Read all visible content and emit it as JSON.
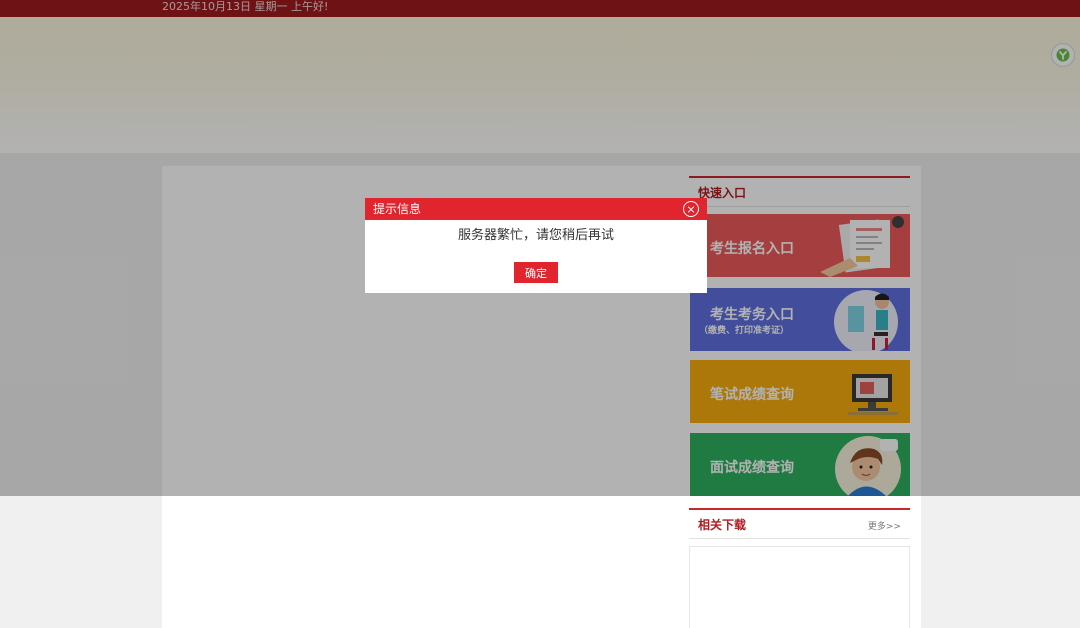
{
  "topbar": {
    "date_text": "2025年10月13日  星期一  上午好!"
  },
  "side_badge": {
    "icon": "y-icon",
    "letter": "Y"
  },
  "sidebar": {
    "quick_entry": {
      "title": "快速入口",
      "cards": [
        {
          "label": "考生报名入口",
          "color": "#ec5b5b"
        },
        {
          "label": "考生考务入口",
          "sub": "（缴费、打印准考证）",
          "color": "#5f6fe0"
        },
        {
          "label": "笔试成绩查询",
          "color": "#f6ad0f"
        },
        {
          "label": "面试成绩查询",
          "color": "#2fb05f"
        }
      ]
    },
    "downloads": {
      "title": "相关下载",
      "more": "更多>>"
    }
  },
  "dialog": {
    "title": "提示信息",
    "message": "服务器繁忙，请您稍后再试",
    "ok_label": "确定"
  }
}
